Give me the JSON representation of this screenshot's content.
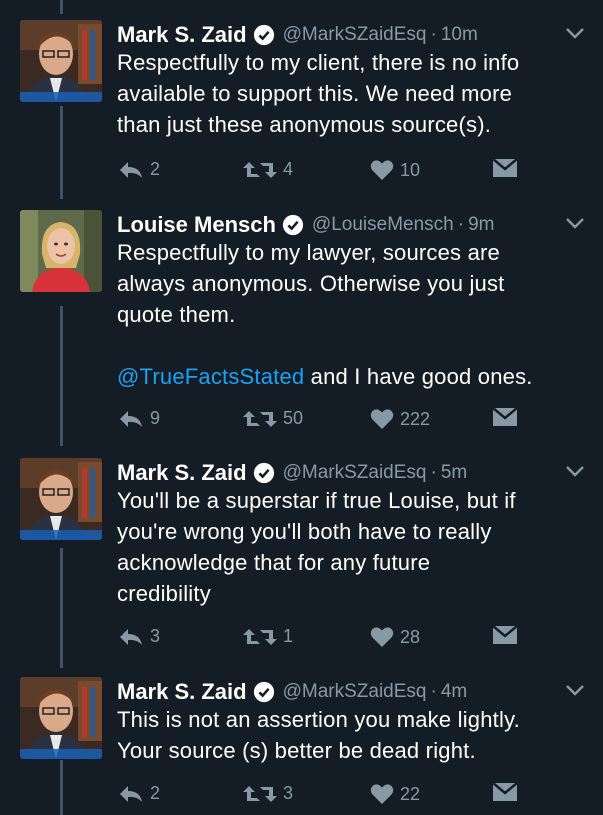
{
  "tweets": [
    {
      "name": "Mark S. Zaid",
      "handle": "@MarkSZaidEsq",
      "sep": "·",
      "time": "10m",
      "lines": [
        "Respectfully to my client, there is no info",
        "available to support this. We need more",
        "than just these anonymous source(s)."
      ],
      "replies": "2",
      "retweets": "4",
      "likes": "10"
    },
    {
      "name": "Louise Mensch",
      "handle": "@LouiseMensch",
      "sep": "·",
      "time": "9m",
      "lines": [
        "Respectfully to my lawyer, sources are",
        "always anonymous. Otherwise you just",
        "quote them."
      ],
      "mention": "@TrueFactsStated",
      "after_mention": " and I have good ones.",
      "replies": "9",
      "retweets": "50",
      "likes": "222"
    },
    {
      "name": "Mark S. Zaid",
      "handle": "@MarkSZaidEsq",
      "sep": "·",
      "time": "5m",
      "lines": [
        "You'll be a superstar if true Louise, but if",
        "you're wrong you'll both have to really",
        "acknowledge that for any future",
        "credibility"
      ],
      "replies": "3",
      "retweets": "1",
      "likes": "28"
    },
    {
      "name": "Mark S. Zaid",
      "handle": "@MarkSZaidEsq",
      "sep": "·",
      "time": "4m",
      "lines": [
        "This is not an assertion you make lightly.",
        "Your source (s) better be dead right."
      ],
      "replies": "2",
      "retweets": "3",
      "likes": "22"
    }
  ],
  "colors": {
    "background": "#141d26",
    "muted": "#8899a6",
    "link": "#1da1f2",
    "thread": "#3d5466"
  },
  "icons": [
    "reply-icon",
    "retweet-icon",
    "heart-icon",
    "message-icon",
    "verified-icon",
    "chevron-down-icon"
  ]
}
